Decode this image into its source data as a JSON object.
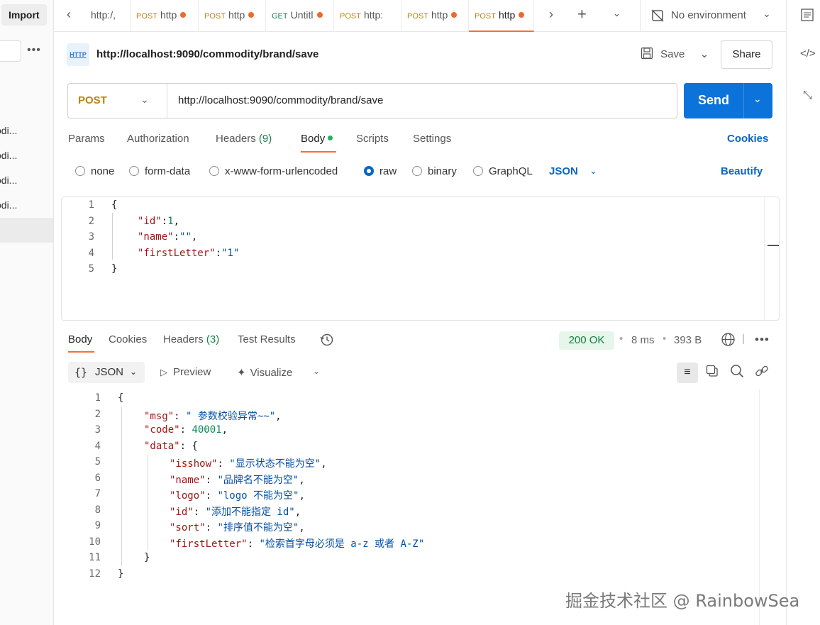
{
  "sidebar": {
    "import_label": "Import",
    "more_label": "•••",
    "items": [
      {
        "label": "odi..."
      },
      {
        "label": "odi..."
      },
      {
        "label": "odi..."
      },
      {
        "label": "odi..."
      }
    ]
  },
  "tabs": [
    {
      "method": "",
      "label": "http:/,",
      "unsaved": false
    },
    {
      "method": "POST",
      "label": "http",
      "unsaved": true
    },
    {
      "method": "POST",
      "label": "http",
      "unsaved": true
    },
    {
      "method": "GET",
      "label": "Untitl",
      "unsaved": true
    },
    {
      "method": "POST",
      "label": "http:",
      "unsaved": false
    },
    {
      "method": "POST",
      "label": "http",
      "unsaved": true
    },
    {
      "method": "POST",
      "label": "http",
      "unsaved": true,
      "active": true
    }
  ],
  "environment": {
    "label": "No environment"
  },
  "request": {
    "title": "http://localhost:9090/commodity/brand/save",
    "http_badge": "HTTP",
    "save_label": "Save",
    "share_label": "Share",
    "method": "POST",
    "url": "http://localhost:9090/commodity/brand/save",
    "send_label": "Send",
    "tabs": {
      "params": "Params",
      "authorization": "Authorization",
      "headers": "Headers",
      "headers_count": "(9)",
      "body": "Body",
      "scripts": "Scripts",
      "settings": "Settings"
    },
    "cookies_label": "Cookies",
    "body_types": [
      "none",
      "form-data",
      "x-www-form-urlencoded",
      "raw",
      "binary",
      "GraphQL"
    ],
    "selected_body_type": "raw",
    "raw_format": "JSON",
    "beautify_label": "Beautify",
    "body_lines": [
      "1",
      "2",
      "3",
      "4",
      "5"
    ]
  },
  "response": {
    "tabs": {
      "body": "Body",
      "cookies": "Cookies",
      "headers": "Headers",
      "headers_count": "(3)",
      "test_results": "Test Results"
    },
    "status": "200 OK",
    "time": "8 ms",
    "size": "393 B",
    "format": "JSON",
    "preview_label": "Preview",
    "visualize_label": "Visualize",
    "line_numbers": [
      "1",
      "2",
      "3",
      "4",
      "5",
      "6",
      "7",
      "8",
      "9",
      "10",
      "11",
      "12"
    ],
    "body": {
      "msg": "\" 参数校验异常~~\"",
      "code": "40001",
      "isshow": "\"显示状态不能为空\"",
      "name": "\"品牌名不能为空\"",
      "logo": "\"logo 不能为空\"",
      "id": "\"添加不能指定 id\"",
      "sort": "\"排序值不能为空\"",
      "firstLetter": "\"检索首字母必须是 a-z 或者 A-Z\""
    }
  },
  "watermark": "掘金技术社区 @ RainbowSea"
}
